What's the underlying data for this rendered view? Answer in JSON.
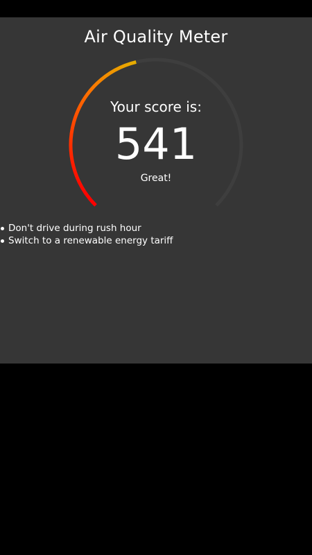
{
  "app": {
    "title": "Air Quality Meter",
    "score_label": "Your score is:",
    "score_value": "541",
    "score_rating": "Great!",
    "gauge_fill_fraction": 0.45,
    "colors": {
      "background": "#363636",
      "gauge_track": "#3e3e3e",
      "gauge_start": "#ff0000",
      "gauge_mid": "#ff6a00",
      "gauge_end": "#ddc600"
    },
    "tips": [
      {
        "text": "Don't drive during rush hour"
      },
      {
        "text": "Switch to a renewable energy tariff"
      }
    ]
  }
}
